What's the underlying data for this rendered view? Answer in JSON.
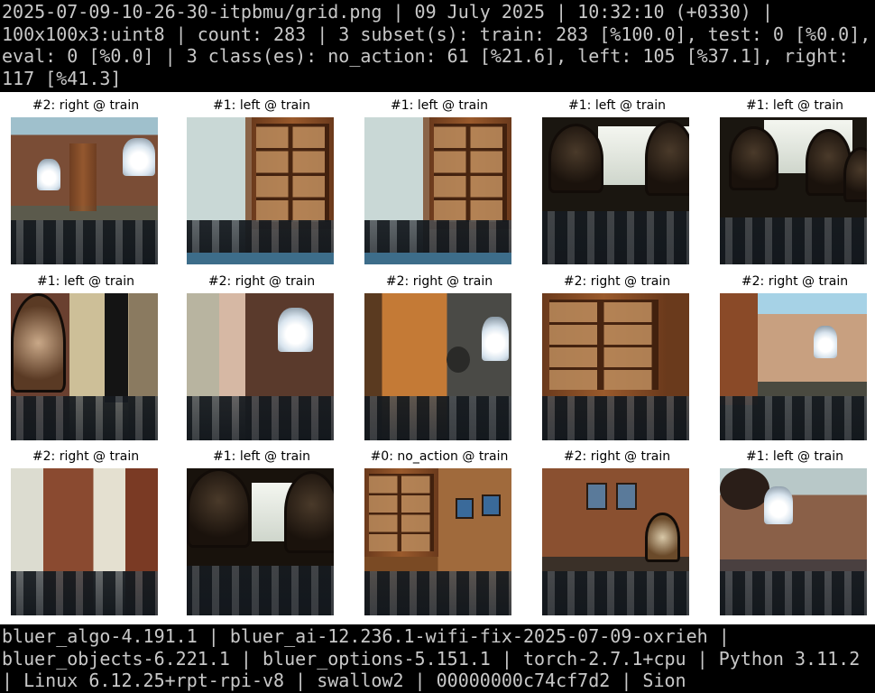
{
  "header": {
    "lines": [
      "2025-07-09-10-26-30-itpbmu/grid.png | 09 July 2025 | 10:32:10 (+0330) |",
      "100x100x3:uint8 | count: 283 | 3 subset(s): train: 283 [%100.0], test: 0 [%0.0],",
      "eval: 0 [%0.0] | 3 class(es): no_action: 61 [%21.6], left: 105 [%37.1], right:",
      "117 [%41.3]"
    ]
  },
  "grid": {
    "cells": [
      {
        "label": "#2: right @ train"
      },
      {
        "label": "#1: left @ train"
      },
      {
        "label": "#1: left @ train"
      },
      {
        "label": "#1: left @ train"
      },
      {
        "label": "#1: left @ train"
      },
      {
        "label": "#1: left @ train"
      },
      {
        "label": "#2: right @ train"
      },
      {
        "label": "#2: right @ train"
      },
      {
        "label": "#2: right @ train"
      },
      {
        "label": "#2: right @ train"
      },
      {
        "label": "#2: right @ train"
      },
      {
        "label": "#1: left @ train"
      },
      {
        "label": "#0: no_action @ train"
      },
      {
        "label": "#2: right @ train"
      },
      {
        "label": "#1: left @ train"
      }
    ]
  },
  "footer": {
    "lines": [
      "bluer_algo-4.191.1 | bluer_ai-12.236.1-wifi-fix-2025-07-09-oxrieh |",
      "bluer_objects-6.221.1 | bluer_options-5.151.1 | torch-2.7.1+cpu | Python 3.11.2",
      "| Linux 6.12.25+rpt-rpi-v8 | swallow2 | 00000000c74cf7d2 | Sion"
    ]
  }
}
